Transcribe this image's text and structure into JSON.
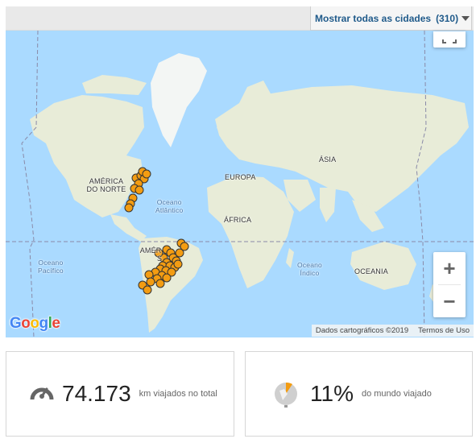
{
  "header": {
    "city_filter_label": "Mostrar todas as cidades",
    "city_filter_count": "(310)"
  },
  "map": {
    "continent_labels": {
      "north_america": "AMÉRICA\nDO NORTE",
      "south_america": "AMÉR",
      "south_america_suffix": "S",
      "europe": "EUROPA",
      "africa": "ÁFRICA",
      "asia": "ÁSIA",
      "oceania": "OCEANIA"
    },
    "ocean_labels": {
      "atlantic": "Oceano\nAtlântico",
      "pacific": "Oceano\nPacífico",
      "indian": "Oceano\nÍndico"
    },
    "attribution": "Dados cartográficos ©2019",
    "terms": "Termos de Uso",
    "zoom_in": "+",
    "zoom_out": "−",
    "logo": "Google",
    "marker_color": "#f39c12",
    "land_color": "#e8ecd8",
    "water_color": "#aadaff"
  },
  "stats": {
    "distance_value": "74.173",
    "distance_caption": "km viajados no total",
    "world_value": "11%",
    "world_caption": "do mundo viajado",
    "world_fraction": 0.11
  }
}
